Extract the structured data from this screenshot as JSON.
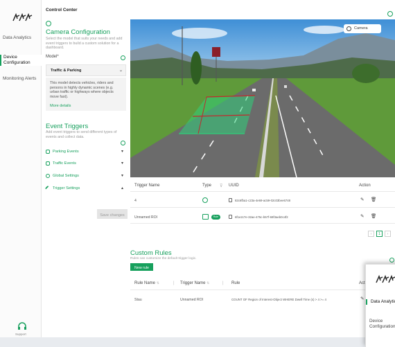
{
  "app": {
    "window_title": "Control Center",
    "colors": {
      "accent": "#17a05d",
      "sidebar_bg": "#fbfbfb"
    }
  },
  "sidebar": {
    "items": [
      {
        "label": "Data Analytics",
        "active": false
      },
      {
        "label": "Device Configuration",
        "active": true
      },
      {
        "label": "Monitoring Alerts",
        "active": false
      }
    ],
    "support_label": "Support"
  },
  "config": {
    "title": "Camera Configuration",
    "description": "Select the model that suits your needs and add event triggers to build a custom solution for a dashboard.",
    "model_label": "Model*",
    "model_value": "Traffic & Parking",
    "model_description": "This model detects vehicles, riders and persons in highly dynamic scenes (e.g. urban traffic or highways where objects move fast).",
    "more_details": "More details",
    "event_triggers_title": "Event Triggers",
    "event_triggers_desc": "Add event triggers to send different types of events and collect data.",
    "accordion": [
      {
        "label": "Parking Events",
        "icon": "parking-icon",
        "chevron": "▾"
      },
      {
        "label": "Traffic Events",
        "icon": "traffic-icon",
        "chevron": "▾"
      },
      {
        "label": "Global Settings",
        "icon": "globe-icon",
        "chevron": "▾"
      },
      {
        "label": "Trigger Settings",
        "icon": "wrench-icon",
        "chevron": "▴"
      }
    ],
    "save_button": "Save changes"
  },
  "camera": {
    "button_label": "Camera"
  },
  "triggers_table": {
    "headers": {
      "name": "Trigger Name",
      "type": "Type",
      "uuid": "UUID",
      "action": "Action"
    },
    "rows": [
      {
        "name": "4",
        "type": "circle",
        "uuid": "82c6fba1-c23a-4e69-ac59-02c03bee6748"
      },
      {
        "name": "Unnamed ROI",
        "type": "roi",
        "badge": "Rule",
        "uuid": "6f1e2c7e-32ae-475c-b57f-69f3aeb0c4f2"
      }
    ],
    "pagination": {
      "current": "1"
    }
  },
  "custom_rules": {
    "title": "Custom Rules",
    "description": "Rules can customize the default trigger logic.",
    "new_rule_button": "New rule",
    "headers": {
      "rule_name": "Rule Name",
      "trigger_name": "Trigger Name",
      "rule": "Rule",
      "action": "Action"
    },
    "rows": [
      {
        "rule_name": "Stau",
        "trigger_name": "Unnamed ROI",
        "rule": "COUNT OF Region of Interest-Object WHERE Dwell Time (s) > 4 >= 4"
      }
    ]
  },
  "second_window": {
    "items": [
      {
        "label": "Data Analytics",
        "active": true
      },
      {
        "label": "Device Configuration",
        "active": false
      }
    ]
  }
}
